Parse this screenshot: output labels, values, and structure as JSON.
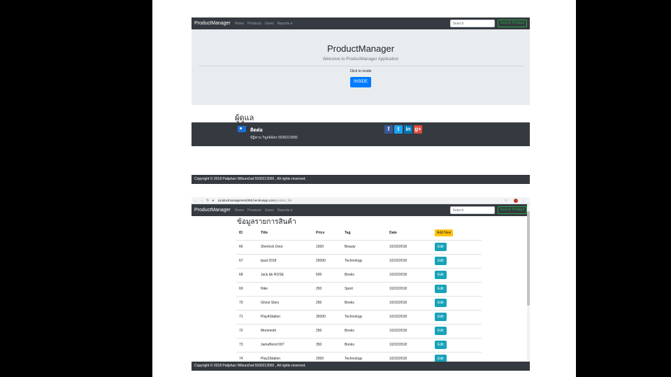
{
  "navbar": {
    "brand": "ProductManager",
    "links": [
      "Home",
      "Products",
      "Users",
      "Reports ▾"
    ],
    "search_placeholder": "Search",
    "search_button": "Search Product"
  },
  "jumbotron": {
    "title": "ProductManager",
    "subtitle": "Welcome to ProductManager Application",
    "click_text": "Click to inside",
    "inside_button": "INSIDE"
  },
  "admin": {
    "heading": "ผู้ดูแล",
    "contact_title": "ติดต่อ",
    "contact_name": "ปัฏิพาน วิบูลย์ฉัตร 5930213055",
    "social": [
      "f",
      "t",
      "in",
      "g+"
    ]
  },
  "footer": {
    "text": "Copyright © 2018 Patiphan Wibunchat 5930213055 , All rights reserved."
  },
  "browser": {
    "url_host": "productmanagement355.herokuapp.com",
    "url_path": "/product_list"
  },
  "product_list": {
    "title": "ข้อมูลรายการสินค้า",
    "columns": [
      "ID",
      "Title",
      "Price",
      "Tag",
      "Date"
    ],
    "add_button": "Add New",
    "edit_label": "Edit",
    "rows": [
      {
        "id": "66",
        "title": "Sherlock Door",
        "price": "1500",
        "tag": "Beauty",
        "date": "10/22/2018"
      },
      {
        "id": "67",
        "title": "Ipad 2018",
        "price": "25000",
        "tag": "Technology",
        "date": "10/22/2018"
      },
      {
        "id": "68",
        "title": "Jack &k ROSE",
        "price": "500",
        "tag": "Books",
        "date": "10/22/2018"
      },
      {
        "id": "69",
        "title": "Nike",
        "price": "250",
        "tag": "Sport",
        "date": "10/22/2018"
      },
      {
        "id": "70",
        "title": "Ghost Story",
        "price": "250",
        "tag": "Books",
        "date": "10/22/2018"
      },
      {
        "id": "71",
        "title": "Play4Station",
        "price": "35000",
        "tag": "Technology",
        "date": "10/22/2018"
      },
      {
        "id": "72",
        "title": "Mommoth",
        "price": "250",
        "tag": "Books",
        "date": "10/22/2018"
      },
      {
        "id": "73",
        "title": "JameBond 007",
        "price": "350",
        "tag": "Books",
        "date": "10/22/2018"
      },
      {
        "id": "74",
        "title": "Play3Station",
        "price": "2000",
        "tag": "Technology",
        "date": "10/22/2018"
      }
    ]
  }
}
